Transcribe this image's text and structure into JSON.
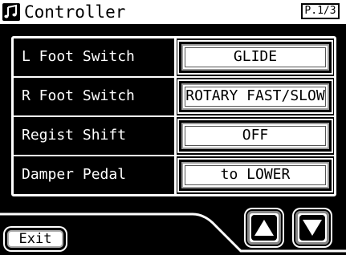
{
  "header": {
    "title": "Controller",
    "page": "P.1/3",
    "icon": "music-note-icon"
  },
  "rows": [
    {
      "label": "L Foot Switch",
      "value": "GLIDE"
    },
    {
      "label": "R Foot Switch",
      "value": "ROTARY FAST/SLOW"
    },
    {
      "label": "Regist Shift",
      "value": "OFF"
    },
    {
      "label": "Damper Pedal",
      "value": "to LOWER"
    }
  ],
  "footer": {
    "exit_label": "Exit",
    "up_icon": "arrow-up-icon",
    "down_icon": "arrow-down-icon"
  },
  "colors": {
    "background": "#000000",
    "foreground": "#ffffff"
  }
}
